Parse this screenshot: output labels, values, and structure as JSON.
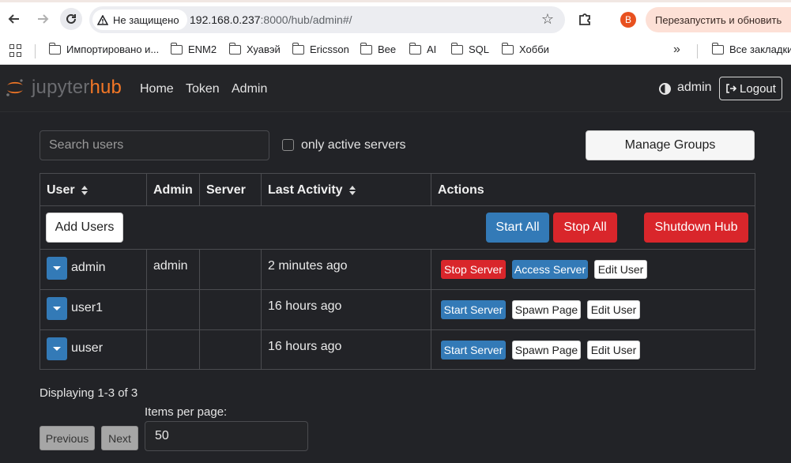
{
  "browser": {
    "security_label": "Не защищено",
    "url_host": "192.168.0.237",
    "url_rest": ":8000/hub/admin#/",
    "profile_initial": "B",
    "relaunch_label": "Перезапустить и обновить",
    "bookmarks": [
      "Импортировано и...",
      "ENM2",
      "Хуавэй",
      "Ericsson",
      "Bee",
      "AI",
      "SQL",
      "Хобби"
    ],
    "all_bookmarks_label": "Все закладки"
  },
  "navbar": {
    "logo_prefix": "jupyter",
    "logo_suffix": "hub",
    "links": [
      "Home",
      "Token",
      "Admin"
    ],
    "user": "admin",
    "logout_label": "Logout"
  },
  "admin": {
    "search_placeholder": "Search users",
    "only_active_label": "only active servers",
    "manage_groups_label": "Manage Groups",
    "columns": [
      "User",
      "Admin",
      "Server",
      "Last Activity",
      "Actions"
    ],
    "add_users_label": "Add Users",
    "start_all_label": "Start All",
    "stop_all_label": "Stop All",
    "shutdown_hub_label": "Shutdown Hub",
    "users": [
      {
        "name": "admin",
        "admin": "admin",
        "server": "",
        "last_activity": "2 minutes ago",
        "actions": [
          "Stop Server",
          "Access Server",
          "Edit User"
        ]
      },
      {
        "name": "user1",
        "admin": "",
        "server": "",
        "last_activity": "16 hours ago",
        "actions": [
          "Start Server",
          "Spawn Page",
          "Edit User"
        ]
      },
      {
        "name": "uuser",
        "admin": "",
        "server": "",
        "last_activity": "16 hours ago",
        "actions": [
          "Start Server",
          "Spawn Page",
          "Edit User"
        ]
      }
    ],
    "display_count": "Displaying 1-3 of 3",
    "items_per_page_label": "Items per page:",
    "items_per_page_value": "50",
    "previous_label": "Previous",
    "next_label": "Next"
  }
}
